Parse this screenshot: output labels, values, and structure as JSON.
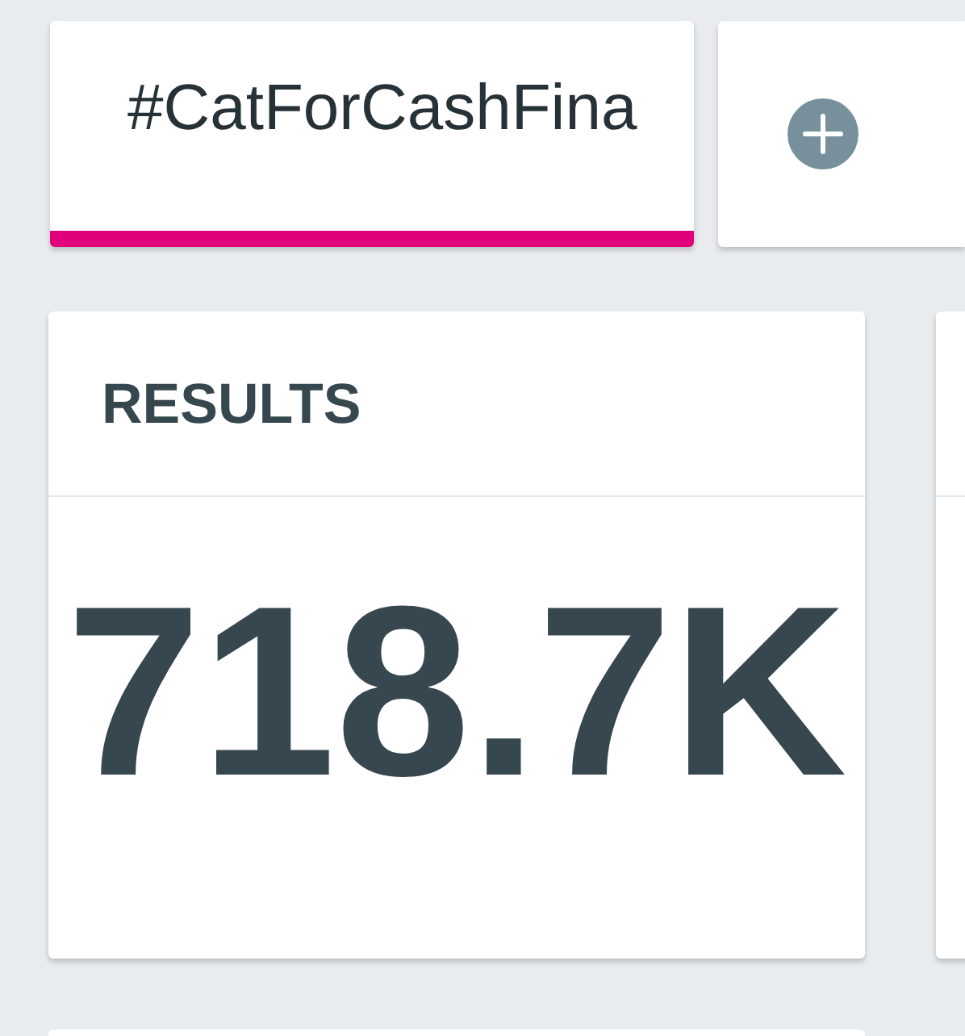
{
  "tabs": [
    {
      "label": "#CatForCashFina",
      "selected": true
    }
  ],
  "cards": [
    {
      "title": "RESULTS",
      "value": "718.7K"
    }
  ]
}
